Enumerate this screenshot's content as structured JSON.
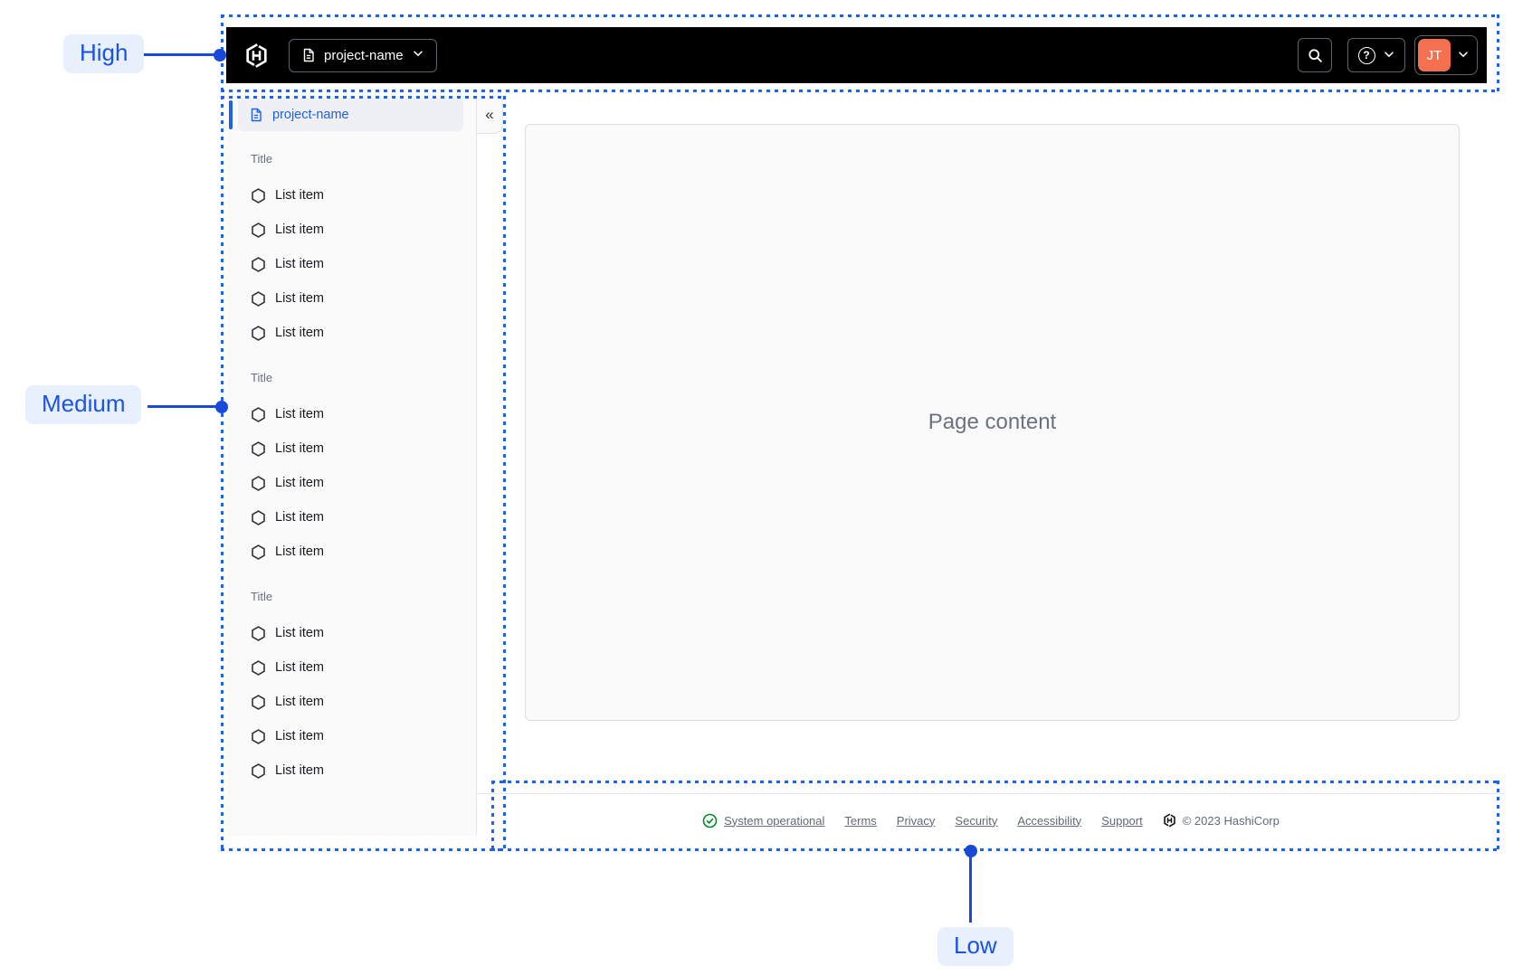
{
  "annotations": {
    "high_label": "High",
    "medium_label": "Medium",
    "low_label": "Low"
  },
  "navbar": {
    "project_switcher_label": "project-name",
    "user_initials": "JT"
  },
  "sidebar": {
    "active_item_label": "project-name",
    "sections": [
      {
        "title": "Title",
        "items": [
          "List item",
          "List item",
          "List item",
          "List item",
          "List item"
        ]
      },
      {
        "title": "Title",
        "items": [
          "List item",
          "List item",
          "List item",
          "List item",
          "List item"
        ]
      },
      {
        "title": "Title",
        "items": [
          "List item",
          "List item",
          "List item",
          "List item",
          "List item"
        ]
      }
    ]
  },
  "content": {
    "placeholder": "Page content"
  },
  "footer": {
    "status_label": "System operational",
    "links": [
      "Terms",
      "Privacy",
      "Security",
      "Accessibility",
      "Support"
    ],
    "copyright": "© 2023 HashiCorp"
  },
  "icons": {
    "brand": "hashicorp-logo",
    "project": "file-text-icon",
    "dropdown": "chevron-down-icon",
    "search": "search-icon",
    "help": "help-icon",
    "collapse": "chevron-double-left-icon",
    "list_item": "hexagon-icon",
    "status": "check-circle-icon"
  },
  "colors": {
    "accent_blue": "#1c5ff2",
    "annotation_blue": "#1d63f0",
    "avatar_orange": "#f4704e",
    "status_green": "#008a22",
    "navbar_bg": "#000000"
  }
}
